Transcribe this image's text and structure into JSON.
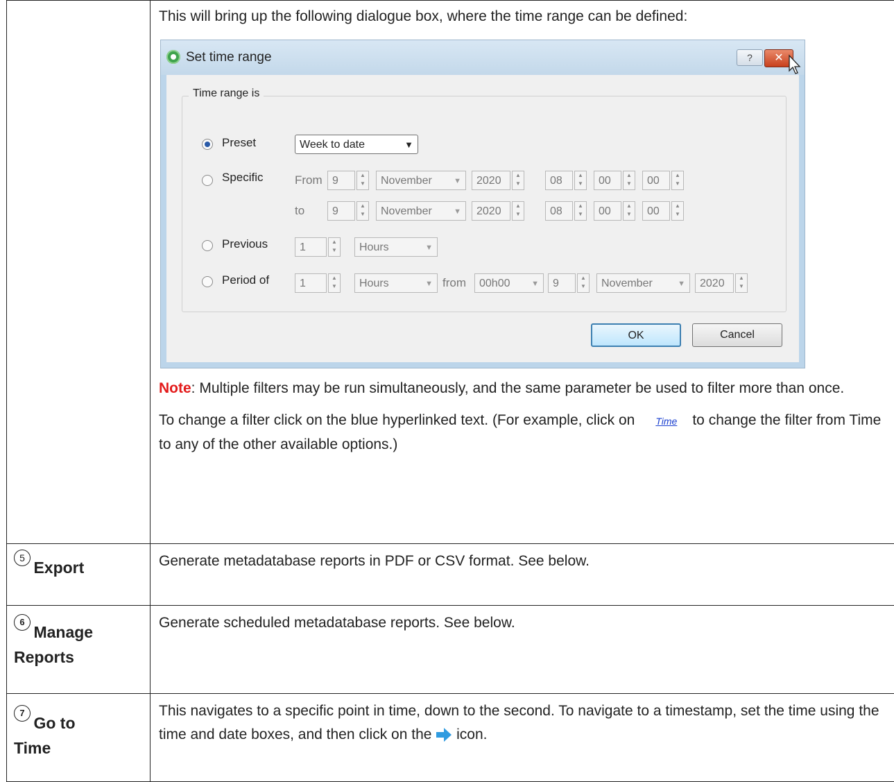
{
  "intro": "This will bring up the following dialogue box, where the time range can be defined:",
  "dialog": {
    "title": "Set time range",
    "help": "?",
    "close": "✕",
    "group_title": "Time range is",
    "preset_label": "Preset",
    "preset_value": "Week to date",
    "specific_label": "Specific",
    "from_label": "From",
    "to_label": "to",
    "from": {
      "day": "9",
      "month": "November",
      "year": "2020",
      "hh": "08",
      "mm": "00",
      "ss": "00"
    },
    "to": {
      "day": "9",
      "month": "November",
      "year": "2020",
      "hh": "08",
      "mm": "00",
      "ss": "00"
    },
    "previous_label": "Previous",
    "previous": {
      "count": "1",
      "unit": "Hours"
    },
    "period_label": "Period of",
    "period": {
      "count": "1",
      "unit": "Hours",
      "from_label": "from",
      "time": "00h00",
      "day": "9",
      "month": "November",
      "year": "2020"
    },
    "ok": "OK",
    "cancel": "Cancel"
  },
  "note": {
    "label": "Note",
    "text": ": Multiple filters may be run simultaneously, and the same parameter be used to filter more than once."
  },
  "change_filter": {
    "before": "To change a filter click on the blue hyperlinked text. (For example, click on",
    "link": "Time",
    "after": "to change the filter from Time to any of the other available options.)"
  },
  "rows": [
    {
      "num": "5",
      "label": "Export",
      "desc": "Generate metadatabase reports in PDF or CSV format. See below."
    },
    {
      "num": "6",
      "label1": "Manage",
      "label2": "Reports",
      "desc": "Generate scheduled metadatabase reports. See below."
    },
    {
      "num": "7",
      "label1": "Go to",
      "label2": "Time",
      "desc_before": "This navigates to a specific point in time, down to the second. To navigate to a timestamp, set the time using the time and date boxes, and then click on the",
      "desc_after": "icon."
    }
  ]
}
